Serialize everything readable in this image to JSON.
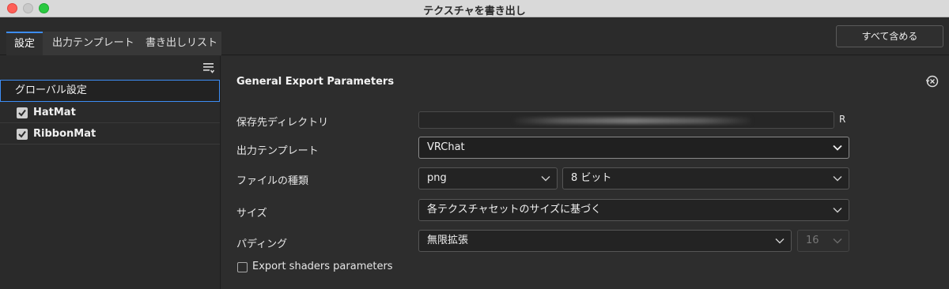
{
  "window": {
    "title": "テクスチャを書き出し"
  },
  "tabs": [
    {
      "label": "設定"
    },
    {
      "label": "出力テンプレート"
    },
    {
      "label": "書き出しリスト"
    }
  ],
  "toolbar": {
    "include_all_label": "すべて含める"
  },
  "sidebar": {
    "global_label": "グローバル設定",
    "materials": [
      {
        "label": "HatMat",
        "checked": true
      },
      {
        "label": "RibbonMat",
        "checked": true
      }
    ]
  },
  "settings": {
    "section_title": "General Export Parameters",
    "directory": {
      "label": "保存先ディレクトリ",
      "suffix": "R"
    },
    "template": {
      "label": "出力テンプレート",
      "value": "VRChat"
    },
    "file_type": {
      "label": "ファイルの種類",
      "format": "png",
      "bit_depth": "8 ビット"
    },
    "size": {
      "label": "サイズ",
      "value": "各テクスチャセットのサイズに基づく"
    },
    "padding": {
      "label": "パディング",
      "value": "無限拡張",
      "amount": "16"
    },
    "export_shaders": {
      "label": "Export shaders parameters",
      "checked": false
    }
  },
  "colors": {
    "accent": "#3d8df5",
    "panel": "#2b2b2b"
  },
  "icons": [
    "close-icon",
    "minimize-icon",
    "maximize-icon",
    "list-settings-icon",
    "checkbox-icon",
    "reset-icon",
    "chevron-down-icon"
  ]
}
